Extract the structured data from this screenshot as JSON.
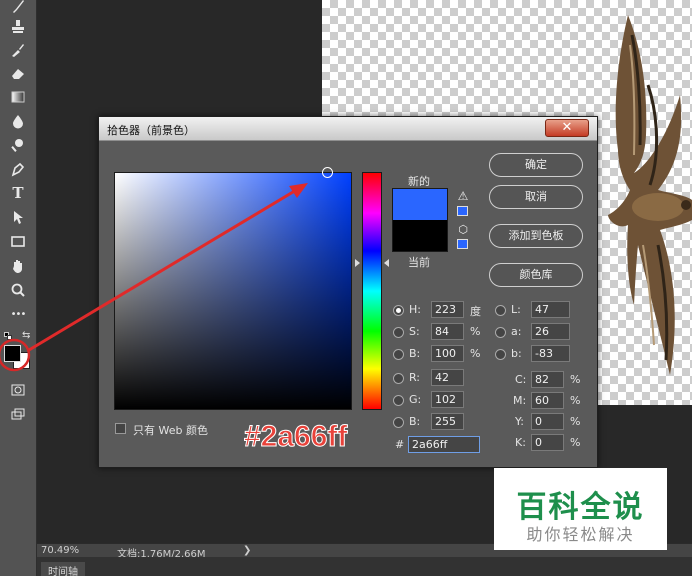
{
  "dialog": {
    "title": "拾色器（前景色）",
    "close_glyph": "✕",
    "new_label": "新的",
    "current_label": "当前",
    "buttons": {
      "ok": "确定",
      "cancel": "取消",
      "add_to_swatches": "添加到色板",
      "color_libraries": "颜色库"
    },
    "fields": {
      "H": {
        "label": "H:",
        "value": "223",
        "unit": "度",
        "selected": true
      },
      "S": {
        "label": "S:",
        "value": "84",
        "unit": "%"
      },
      "B": {
        "label": "B:",
        "value": "100",
        "unit": "%"
      },
      "R": {
        "label": "R:",
        "value": "42"
      },
      "G": {
        "label": "G:",
        "value": "102"
      },
      "Bl": {
        "label": "B:",
        "value": "255"
      },
      "L": {
        "label": "L:",
        "value": "47"
      },
      "a": {
        "label": "a:",
        "value": "26"
      },
      "b": {
        "label": "b:",
        "value": "-83"
      },
      "C": {
        "label": "C:",
        "value": "82",
        "unit": "%"
      },
      "M": {
        "label": "M:",
        "value": "60",
        "unit": "%"
      },
      "Y": {
        "label": "Y:",
        "value": "0",
        "unit": "%"
      },
      "K": {
        "label": "K:",
        "value": "0",
        "unit": "%"
      }
    },
    "hex_label": "#",
    "hex_value": "2a66ff",
    "web_only_label": "只有 Web 颜色",
    "new_color": "#2a66ff",
    "current_color": "#000000"
  },
  "overlay_text": "#2a66ff",
  "statusbar": {
    "zoom": "70.49%",
    "doc": "文档:1.76M/2.66M",
    "arrow": "❯"
  },
  "timeline_tab": "时间轴",
  "toolbar": {
    "type_tool_glyph": "T",
    "more_tools_glyph": "•••",
    "foreground_color": "#000000",
    "background_color": "#ffffff"
  },
  "watermark": {
    "title": "百科全说",
    "subtitle": "助你轻松解决"
  },
  "colors": {
    "annotation_red": "#e02a2a",
    "accent_blue": "#2a66ff"
  }
}
